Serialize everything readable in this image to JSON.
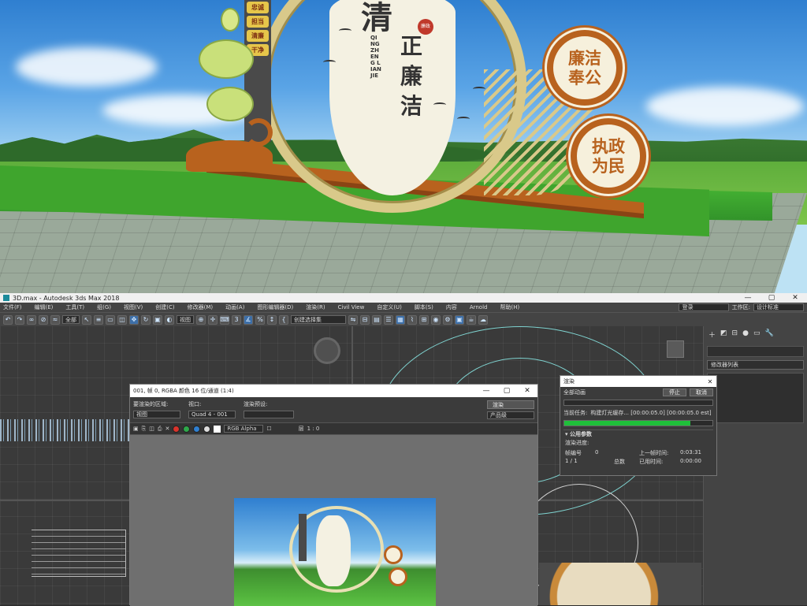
{
  "scene": {
    "sign_big_char": "清",
    "sign_vertical": "正廉洁",
    "sign_pinyin": "QING ZHENG LIAN JIE",
    "sign_seal": "廉政",
    "badge1_lines": [
      "廉洁",
      "奉公"
    ],
    "badge2_lines": [
      "执政",
      "为民"
    ],
    "pole_tags": [
      "忠诚",
      "担当",
      "清廉",
      "干净"
    ]
  },
  "app": {
    "title": "3D.max - Autodesk 3ds Max 2018",
    "window_controls": [
      "—",
      "▢",
      "✕"
    ],
    "menu": [
      "文件(F)",
      "编辑(E)",
      "工具(T)",
      "组(G)",
      "视图(V)",
      "创建(C)",
      "修改器(M)",
      "动画(A)",
      "图形编辑器(D)",
      "渲染(R)",
      "Civil View",
      "自定义(U)",
      "脚本(S)",
      "内容",
      "Arnold",
      "帮助(H)"
    ],
    "login_label": "登录",
    "workspace_label": "工作区:",
    "workspace_value": "设计标准",
    "toolbar": {
      "filter_value": "全部",
      "view_value": "视图",
      "selection_set": "创建选择集",
      "snap_value": "3"
    }
  },
  "command_panel": {
    "modifier_list": "修改器列表"
  },
  "frame_window": {
    "title": "001, 帧 0, RGBA 颜色 16 位/通道 (1:4)",
    "controls": [
      "—",
      "▢",
      "✕"
    ],
    "area_label": "要渲染的区域:",
    "area_value": "视图",
    "viewport_label": "视口:",
    "viewport_value": "Quad 4 - 001",
    "preset_label": "渲染预设:",
    "preset_value": "",
    "render_button": "渲染",
    "product_value": "产品级",
    "channel_value": "RGB Alpha",
    "layer_label": "层",
    "layer_value": "1 : 0",
    "colors": [
      "#d9332b",
      "#2ea84a",
      "#2f7fd0"
    ]
  },
  "render_dialog": {
    "title": "渲染",
    "all_anim_label": "全部动画",
    "stop_button": "停止",
    "cancel_button": "取消",
    "current_task_label": "当前任务:",
    "current_task_value": "构建灯光缓存... [00:00:05.0] [00:00:05.0 est]",
    "progress": 0.85,
    "section": "公用参数",
    "render_progress_label": "渲染进度:",
    "frame_no_label": "帧编号",
    "frame_no_value": "0",
    "frame_count": "1 / 1",
    "total_label": "总数",
    "last_frame_label": "上一帧时间:",
    "last_frame_value": "0:03:31",
    "elapsed_label": "已用时间:",
    "elapsed_value": "0:00:00"
  }
}
